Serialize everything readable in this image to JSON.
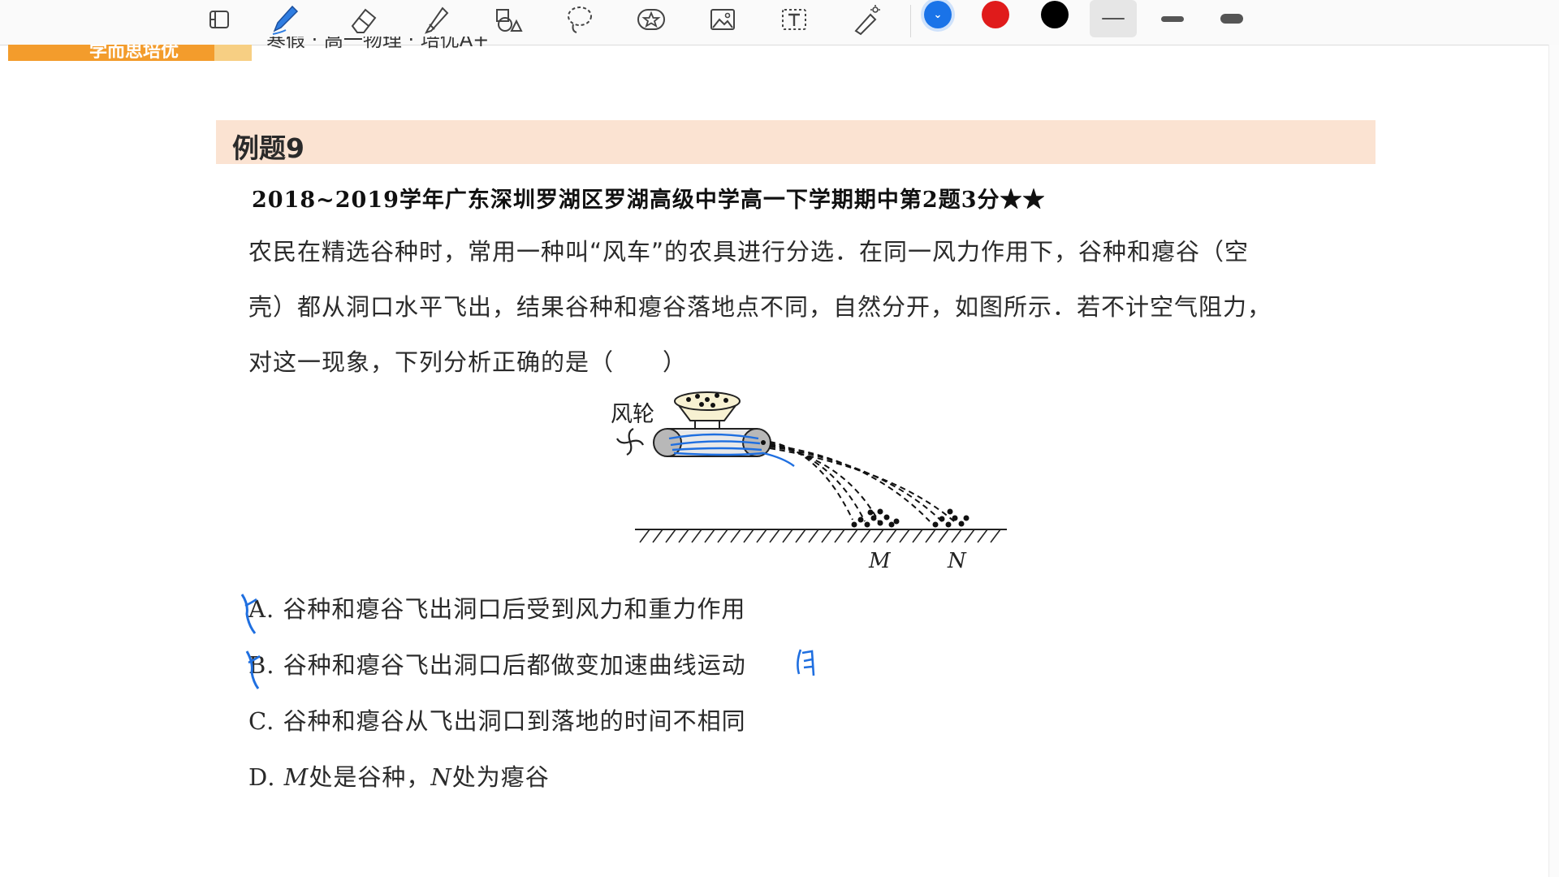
{
  "toolbar": {
    "tools": [
      {
        "name": "page-layout-icon"
      },
      {
        "name": "pen-icon",
        "active": true
      },
      {
        "name": "eraser-icon"
      },
      {
        "name": "highlighter-icon"
      },
      {
        "name": "shapes-icon"
      },
      {
        "name": "lasso-icon"
      },
      {
        "name": "sticker-icon"
      },
      {
        "name": "image-icon"
      },
      {
        "name": "text-box-icon"
      },
      {
        "name": "laser-pointer-icon"
      }
    ],
    "colors": [
      "#1a73e8",
      "#e01b1b",
      "#000000"
    ],
    "selected_color": "#1a73e8",
    "widths": [
      "thin",
      "medium",
      "thick"
    ],
    "selected_width": "thin"
  },
  "doc": {
    "brand": "学而思培优",
    "header": "寒假 · 高一物理 · 培优A+",
    "example_title": "例题9",
    "source": "2018~2019学年广东深圳罗湖区罗湖高级中学高一下学期期中第2题3分★★",
    "question_lines": [
      "农民在精选谷种时，常用一种叫“风车”的农具进行分选．在同一风力作用下，谷种和瘪谷（空",
      "壳）都从洞口水平飞出，结果谷种和瘪谷落地点不同，自然分开，如图所示．若不计空气阻力，",
      "对这一现象，下列分析正确的是（　　）"
    ],
    "figure": {
      "wheel_label": "风轮",
      "mark_m": "M",
      "mark_n": "N"
    },
    "options": [
      {
        "letter": "A.",
        "text": "谷种和瘪谷飞出洞口后受到风力和重力作用"
      },
      {
        "letter": "B.",
        "text": "谷种和瘪谷飞出洞口后都做变加速曲线运动"
      },
      {
        "letter": "C.",
        "text": "谷种和瘪谷从飞出洞口到落地的时间不相同"
      },
      {
        "letter": "D.",
        "m": "M",
        "mid": "处是谷种，",
        "n": "N",
        "tail": "处为瘪谷"
      }
    ]
  }
}
